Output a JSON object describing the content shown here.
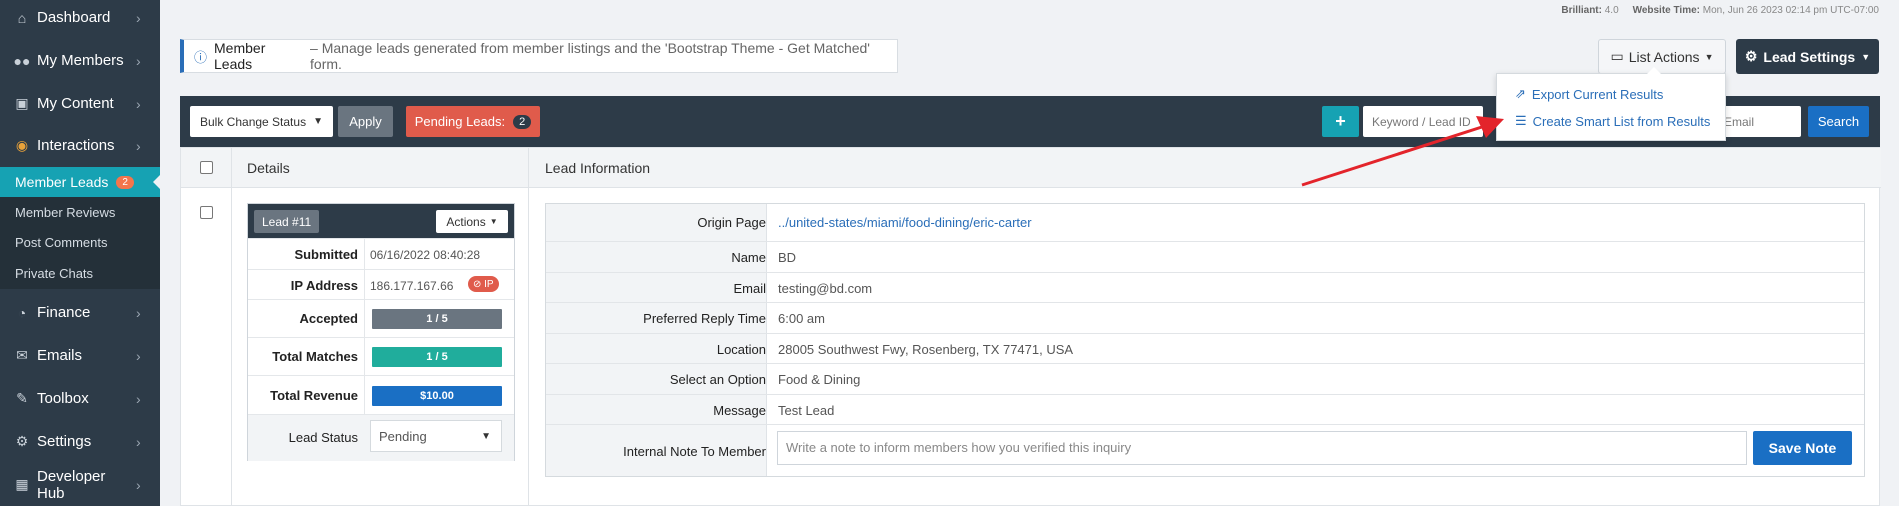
{
  "sidebar": {
    "items": [
      {
        "label": "Dashboard",
        "icon": "dashboard-icon"
      },
      {
        "label": "My Members",
        "icon": "users-icon"
      },
      {
        "label": "My Content",
        "icon": "content-icon"
      },
      {
        "label": "Interactions",
        "icon": "chat-icon"
      },
      {
        "label": "Finance",
        "icon": "pie-chart-icon"
      },
      {
        "label": "Emails",
        "icon": "envelope-icon"
      },
      {
        "label": "Toolbox",
        "icon": "wrench-icon"
      },
      {
        "label": "Settings",
        "icon": "gear-icon"
      },
      {
        "label": "Developer Hub",
        "icon": "grid-icon"
      }
    ],
    "subitems": [
      {
        "label": "Member Leads",
        "badge": "2"
      },
      {
        "label": "Member Reviews"
      },
      {
        "label": "Post Comments"
      },
      {
        "label": "Private Chats"
      }
    ]
  },
  "topmeta": {
    "brilliant_label": "Brilliant:",
    "brilliant_value": "4.0",
    "time_label": "Website Time:",
    "time_value": "Mon, Jun 26 2023 02:14 pm UTC-07:00"
  },
  "header": {
    "title": "Member Leads",
    "description": "– Manage leads generated from member listings and the 'Bootstrap Theme - Get Matched' form.",
    "list_actions": "List Actions",
    "lead_settings": "Lead Settings"
  },
  "dropdown": {
    "items": [
      "Export Current Results",
      "Create Smart List from Results"
    ]
  },
  "toolbar": {
    "bulk_select": "Bulk Change Status",
    "apply": "Apply",
    "pending_label": "Pending Leads:",
    "pending_count": "2",
    "plus": "+",
    "keyword_placeholder": "Keyword / Lead ID",
    "email_placeholder": "Email",
    "search": "Search"
  },
  "table": {
    "headers": [
      "Details",
      "Lead Information"
    ]
  },
  "lead": {
    "tag": "Lead #11",
    "actions": "Actions",
    "rows": [
      {
        "key": "Submitted",
        "value": "06/16/2022 08:40:28"
      },
      {
        "key": "IP Address",
        "value": "186.177.167.66",
        "badge": "⊘ IP"
      },
      {
        "key": "Accepted",
        "value": "1 / 5"
      },
      {
        "key": "Total Matches",
        "value": "1 / 5"
      },
      {
        "key": "Total Revenue",
        "value": "$10.00"
      },
      {
        "key": "Lead Status",
        "value": "Pending"
      }
    ]
  },
  "info": {
    "rows": [
      {
        "key": "Origin Page",
        "value": "../united-states/miami/food-dining/eric-carter"
      },
      {
        "key": "Name",
        "value": "BD"
      },
      {
        "key": "Email",
        "value": "testing@bd.com"
      },
      {
        "key": "Preferred Reply Time",
        "value": "6:00 am"
      },
      {
        "key": "Location",
        "value": "28005 Southwest Fwy, Rosenberg, TX 77471, USA"
      },
      {
        "key": "Select an Option",
        "value": "Food & Dining"
      },
      {
        "key": "Message",
        "value": "Test Lead"
      },
      {
        "key": "Internal Note To Member",
        "value": ""
      }
    ],
    "note_placeholder": "Write a note to inform members how you verified this inquiry",
    "save_note": "Save Note"
  },
  "colors": {
    "sidebar": "#2d3b48",
    "accent_teal": "#16a2b3",
    "accent_blue": "#1a6fc4",
    "danger": "#e05b4b",
    "annotation_arrow": "#e3242b"
  }
}
